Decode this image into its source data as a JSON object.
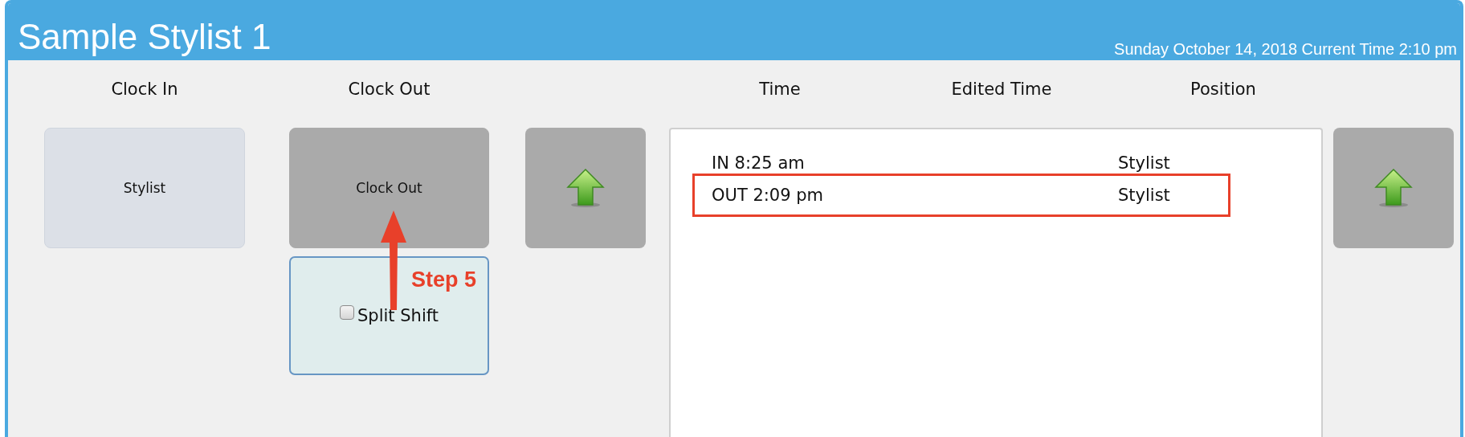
{
  "header": {
    "title": "Sample Stylist 1",
    "datetime": "Sunday October 14, 2018 Current Time 2:10 pm"
  },
  "clock_in": {
    "label": "Clock In",
    "position_button": "Stylist"
  },
  "clock_out": {
    "label": "Clock Out",
    "button": "Clock Out",
    "split_shift": {
      "label": "Split Shift",
      "checked": false
    }
  },
  "punches": {
    "columns": [
      "Time",
      "Edited Time",
      "Position"
    ],
    "rows": [
      {
        "time": "IN 8:25 am",
        "position": "Stylist",
        "selected": false
      },
      {
        "time": "OUT 2:09 pm",
        "position": "Stylist",
        "selected": true
      }
    ]
  },
  "annotation": {
    "label": "Step 5"
  }
}
